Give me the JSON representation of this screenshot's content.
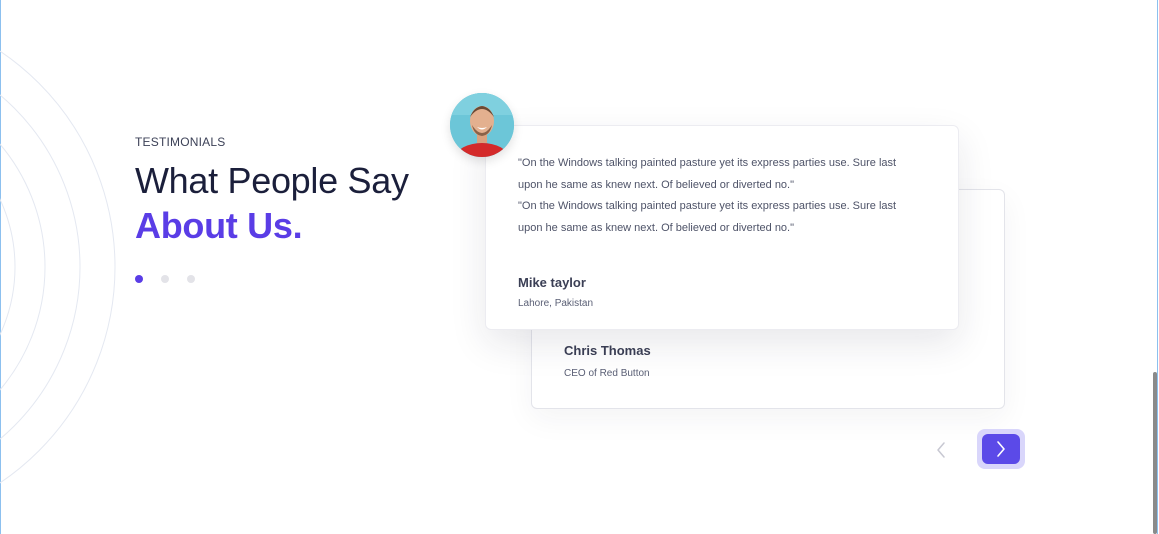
{
  "section": {
    "eyebrow": "TESTIMONIALS",
    "title_line1": "What People Say",
    "title_line2": "About Us.",
    "pagination": {
      "count": 3,
      "active_index": 0
    }
  },
  "testimonials": [
    {
      "quote_lines": [
        "\"On the Windows talking painted pasture yet its express parties use. Sure last upon he same as knew next. Of believed or diverted no.\"",
        "\"On the Windows talking painted pasture yet its express parties use. Sure last upon he same as knew next. Of believed or diverted no.\""
      ],
      "name": "Mike taylor",
      "role": "Lahore, Pakistan"
    },
    {
      "name": "Chris Thomas",
      "role": "CEO of Red Button"
    }
  ],
  "navigation": {
    "prev_icon": "chevron-left-icon",
    "next_icon": "chevron-right-icon"
  },
  "colors": {
    "accent": "#5a3de6",
    "button": "#5b4ae8",
    "button_ring": "#d9d6fb",
    "heading": "#1b1f3b",
    "body_text": "#4e5368",
    "frame_line": "#8cc0ef"
  }
}
